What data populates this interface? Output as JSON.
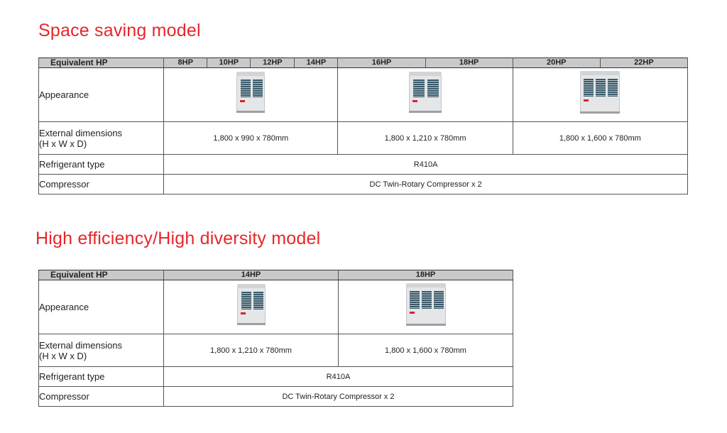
{
  "sections": [
    {
      "title": "Space saving model",
      "header_label": "Equivalent HP",
      "hp": [
        "8HP",
        "10HP",
        "12HP",
        "14HP",
        "16HP",
        "18HP",
        "20HP",
        "22HP"
      ],
      "rows": {
        "appearance": "Appearance",
        "dimensions_line1": "External dimensions",
        "dimensions_line2": "(H x W x D)",
        "refrigerant": "Refrigerant type",
        "compressor": "Compressor"
      },
      "dimensions": [
        "1,800 x 990 x 780mm",
        "1,800 x 1,210 x 780mm",
        "1,800 x 1,600 x 780mm"
      ],
      "refrigerant": "R410A",
      "compressor": "DC Twin-Rotary Compressor x 2"
    },
    {
      "title": "High efficiency/High diversity model",
      "header_label": "Equivalent HP",
      "hp": [
        "14HP",
        "18HP"
      ],
      "rows": {
        "appearance": "Appearance",
        "dimensions_line1": "External dimensions",
        "dimensions_line2": "(H x W x D)",
        "refrigerant": "Refrigerant type",
        "compressor": "Compressor"
      },
      "dimensions": [
        "1,800 x 1,210 x 780mm",
        "1,800 x 1,600 x 780mm"
      ],
      "refrigerant": "R410A",
      "compressor": "DC Twin-Rotary Compressor x 2"
    }
  ],
  "colors": {
    "title": "#e8262b",
    "header_bg": "#c9c9c9",
    "border": "#555555"
  },
  "icons": [
    "outdoor-unit-small-icon",
    "outdoor-unit-medium-icon",
    "outdoor-unit-large-icon"
  ]
}
